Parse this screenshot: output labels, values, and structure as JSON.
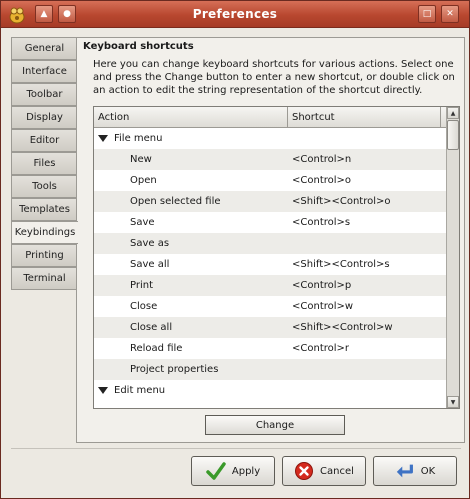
{
  "window": {
    "title": "Preferences"
  },
  "tabs": [
    {
      "label": "General"
    },
    {
      "label": "Interface"
    },
    {
      "label": "Toolbar"
    },
    {
      "label": "Display"
    },
    {
      "label": "Editor"
    },
    {
      "label": "Files"
    },
    {
      "label": "Tools"
    },
    {
      "label": "Templates"
    },
    {
      "label": "Keybindings",
      "active": true
    },
    {
      "label": "Printing"
    },
    {
      "label": "Terminal"
    }
  ],
  "keybindings": {
    "section_title": "Keyboard shortcuts",
    "description": "Here you can change keyboard shortcuts for various actions. Select one and press the Change button to enter a new shortcut, or double click on an action to edit the string representation of the shortcut directly.",
    "columns": {
      "action": "Action",
      "shortcut": "Shortcut"
    },
    "rows": [
      {
        "action": "File menu",
        "shortcut": "",
        "group": true
      },
      {
        "action": "New",
        "shortcut": "<Control>n"
      },
      {
        "action": "Open",
        "shortcut": "<Control>o"
      },
      {
        "action": "Open selected file",
        "shortcut": "<Shift><Control>o"
      },
      {
        "action": "Save",
        "shortcut": "<Control>s"
      },
      {
        "action": "Save as",
        "shortcut": ""
      },
      {
        "action": "Save all",
        "shortcut": "<Shift><Control>s"
      },
      {
        "action": "Print",
        "shortcut": "<Control>p"
      },
      {
        "action": "Close",
        "shortcut": "<Control>w"
      },
      {
        "action": "Close all",
        "shortcut": "<Shift><Control>w"
      },
      {
        "action": "Reload file",
        "shortcut": "<Control>r"
      },
      {
        "action": "Project properties",
        "shortcut": ""
      },
      {
        "action": "Edit menu",
        "shortcut": "",
        "group": true
      }
    ],
    "change_label": "Change"
  },
  "buttons": {
    "apply": "Apply",
    "cancel": "Cancel",
    "ok": "OK"
  },
  "colors": {
    "titlebar": "#b8472f",
    "apply_icon": "#3a9a2a",
    "cancel_icon": "#d42a1e",
    "ok_icon": "#3f73c4"
  }
}
